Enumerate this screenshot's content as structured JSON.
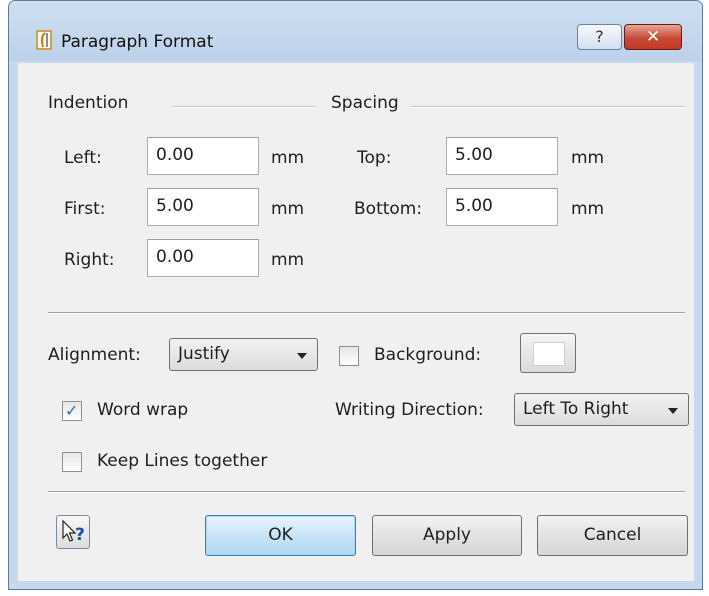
{
  "window": {
    "title": "Paragraph Format",
    "app_icon": "paragraph-format-icon",
    "help_glyph": "?",
    "close_glyph": "✕"
  },
  "indention": {
    "group_label": "Indention",
    "left_label": "Left:",
    "left_value": "0.00",
    "first_label": "First:",
    "first_value": "5.00",
    "right_label": "Right:",
    "right_value": "0.00",
    "unit": "mm"
  },
  "spacing": {
    "group_label": "Spacing",
    "top_label": "Top:",
    "top_value": "5.00",
    "bottom_label": "Bottom:",
    "bottom_value": "5.00",
    "unit": "mm"
  },
  "options": {
    "alignment_label": "Alignment:",
    "alignment_value": "Justify",
    "background_label": "Background:",
    "background_checked": false,
    "background_color": "#ffffff",
    "word_wrap_label": "Word wrap",
    "word_wrap_checked": true,
    "writing_direction_label": "Writing Direction:",
    "writing_direction_value": "Left To Right",
    "keep_lines_label": "Keep Lines together",
    "keep_lines_checked": false
  },
  "buttons": {
    "whats_this_icon": "whats-this-help-icon",
    "ok": "OK",
    "apply": "Apply",
    "cancel": "Cancel"
  }
}
